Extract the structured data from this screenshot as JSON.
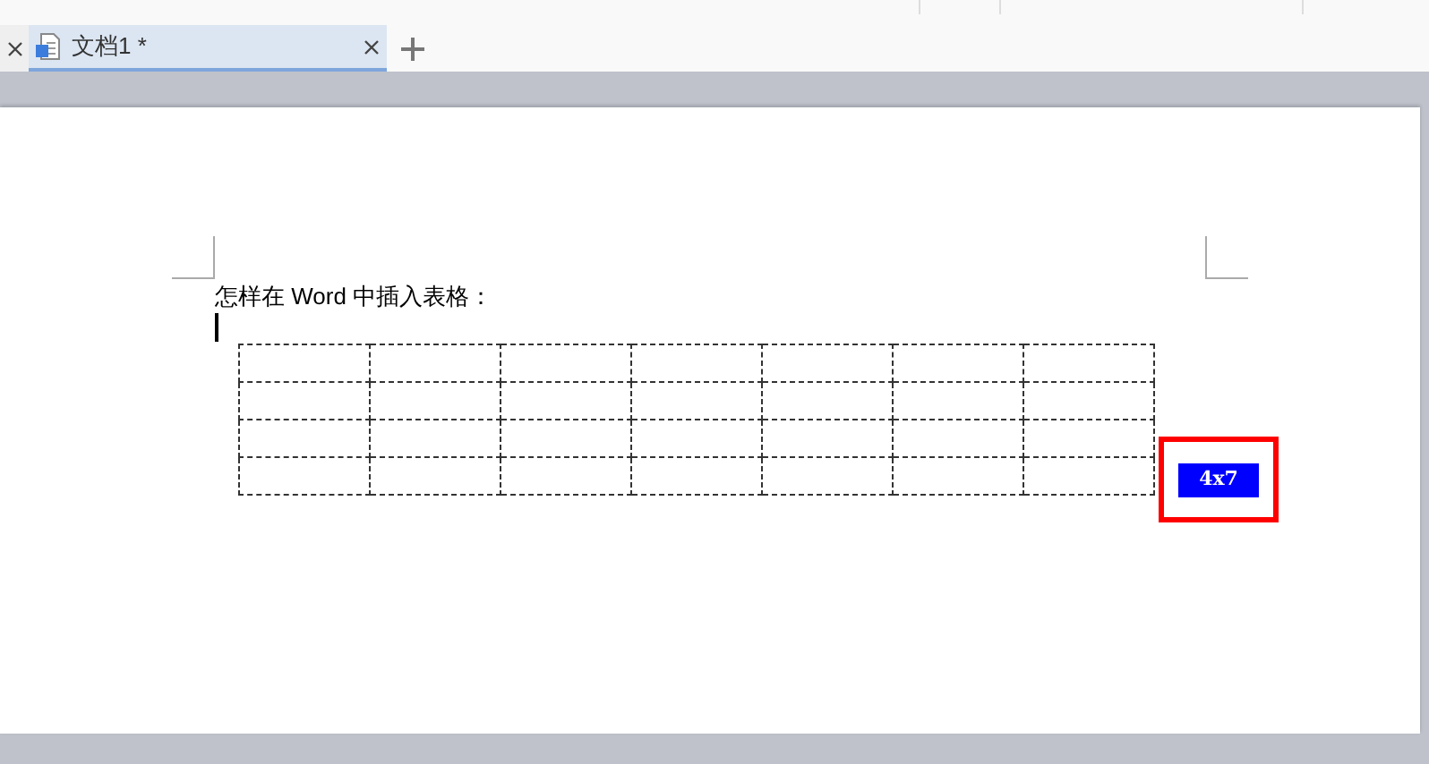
{
  "tabs": [
    {
      "label": "文档1 *",
      "selected": true
    }
  ],
  "document": {
    "paragraph": "怎样在 Word 中插入表格：",
    "table": {
      "rows": [
        {
          "cells": [
            {
              "kind": "empty"
            },
            {
              "kind": "empty"
            },
            {
              "kind": "empty"
            },
            {
              "kind": "empty"
            },
            {
              "kind": "empty"
            },
            {
              "kind": "empty"
            },
            {
              "kind": "empty"
            }
          ]
        },
        {
          "cells": [
            {
              "kind": "empty"
            },
            {
              "kind": "empty"
            },
            {
              "kind": "empty"
            },
            {
              "kind": "empty"
            },
            {
              "kind": "empty"
            },
            {
              "kind": "empty"
            },
            {
              "kind": "empty"
            }
          ]
        },
        {
          "cells": [
            {
              "kind": "empty"
            },
            {
              "kind": "empty"
            },
            {
              "kind": "empty"
            },
            {
              "kind": "empty"
            },
            {
              "kind": "empty"
            },
            {
              "kind": "empty"
            },
            {
              "kind": "empty"
            }
          ]
        },
        {
          "cells": [
            {
              "kind": "empty"
            },
            {
              "kind": "empty"
            },
            {
              "kind": "empty"
            },
            {
              "kind": "empty"
            },
            {
              "kind": "empty"
            },
            {
              "kind": "empty"
            },
            {
              "kind": "empty"
            }
          ]
        }
      ]
    },
    "size_label": "4x7"
  }
}
